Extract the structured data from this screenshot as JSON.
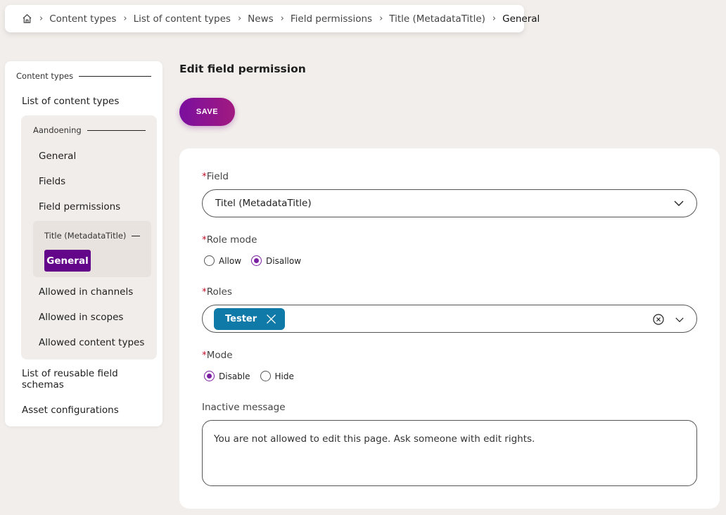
{
  "breadcrumb": {
    "items": [
      "Content types",
      "List of content types",
      "News",
      "Field permissions",
      "Title (MetadataTitle)",
      "General"
    ]
  },
  "sidebar": {
    "group_label": "Content types",
    "list_content_types": "List of content types",
    "sub_group_label": "Aandoening",
    "items": [
      "General",
      "Fields",
      "Field permissions"
    ],
    "nested_group_label": "Title (MetadataTitle)",
    "active_item": "General",
    "items_after": [
      "Allowed in channels",
      "Allowed in scopes",
      "Allowed content types"
    ],
    "reusable": "List of reusable field schemas",
    "asset_configurations": "Asset configurations"
  },
  "main": {
    "title": "Edit field permission",
    "save_label": "SAVE"
  },
  "form": {
    "required_mark": "*",
    "field_label": "Field",
    "field_value": "Titel (MetadataTitle)",
    "role_mode_label": "Role mode",
    "role_mode_options": [
      "Allow",
      "Disallow"
    ],
    "role_mode_selected": "Disallow",
    "roles_label": "Roles",
    "roles_selected": [
      "Tester"
    ],
    "mode_label": "Mode",
    "mode_options": [
      "Disable",
      "Hide"
    ],
    "mode_selected": "Disable",
    "inactive_label": "Inactive message",
    "inactive_value": "You are not allowed to edit this page. Ask someone with edit rights."
  },
  "colors": {
    "accent_purple": "#64068a",
    "chip_blue": "#0f79a8",
    "required_red": "#c0102a",
    "background": "#f2eeeb"
  }
}
